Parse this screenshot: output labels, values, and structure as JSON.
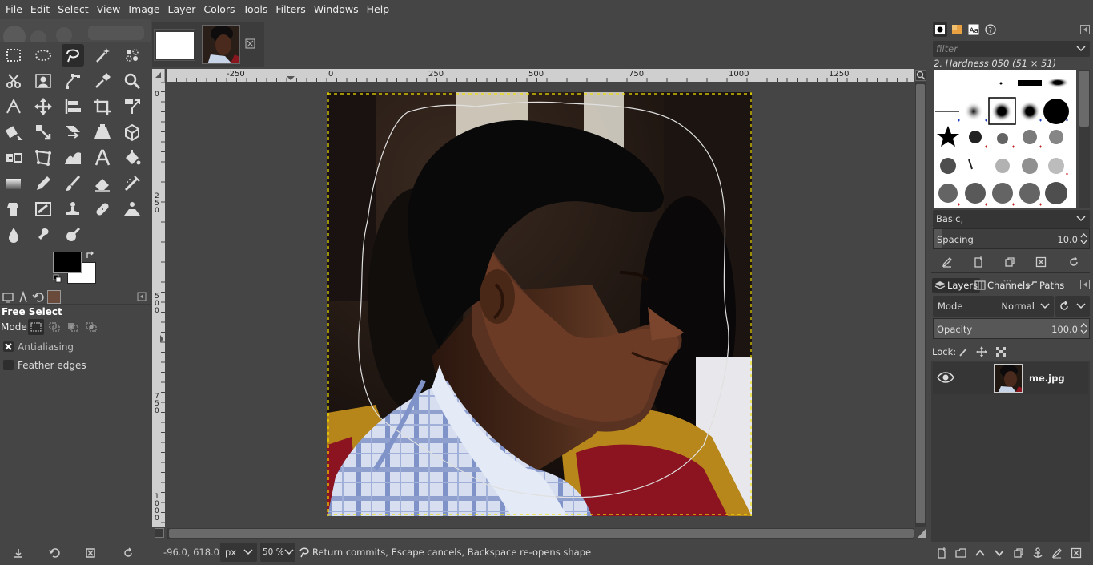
{
  "menubar": {
    "items": [
      "File",
      "Edit",
      "Select",
      "View",
      "Image",
      "Layer",
      "Colors",
      "Tools",
      "Filters",
      "Windows",
      "Help"
    ]
  },
  "toolbox": {
    "tools": [
      "rect-select-icon",
      "ellipse-select-icon",
      "free-select-icon",
      "fuzzy-select-icon",
      "color-select-icon",
      "scissors-select-icon",
      "foreground-select-icon",
      "paths-icon",
      "color-picker-icon",
      "zoom-icon",
      "measure-icon",
      "move-icon",
      "align-icon",
      "crop-icon",
      "unified-transform-icon",
      "rotate-icon",
      "scale-icon",
      "shear-icon",
      "perspective-icon",
      "3d-transform-icon",
      "flip-icon",
      "cage-transform-icon",
      "warp-transform-icon",
      "text-icon",
      "bucket-fill-icon",
      "gradient-icon",
      "pencil-icon",
      "paintbrush-icon",
      "eraser-icon",
      "airbrush-icon",
      "ink-icon",
      "mypaint-brush-icon",
      "clone-icon",
      "heal-icon",
      "perspective-clone-icon",
      "blur-icon",
      "smudge-icon",
      "dodge-burn-icon"
    ],
    "active_tool": "free-select-icon",
    "fg_color": "#000000",
    "bg_color": "#ffffff"
  },
  "tool_options": {
    "title": "Free Select",
    "mode_label": "Mode:",
    "antialiasing_label": "Antialiasing",
    "antialiasing_checked": true,
    "feather_label": "Feather edges",
    "feather_checked": false
  },
  "rulers": {
    "top_labels": [
      "-250",
      "0",
      "250",
      "500",
      "750",
      "1000",
      "1250"
    ],
    "left_labels": [
      "0",
      "2\n5\n0",
      "5\n0\n0",
      "7\n5\n0",
      "1\n0\n0\n0"
    ]
  },
  "statusbar": {
    "coords": "-96.0, 618.0",
    "unit": "px",
    "zoom": "50 %",
    "message": "Return commits, Escape cancels, Backspace re-opens shape"
  },
  "brushes": {
    "filter_placeholder": "filter",
    "selected_brush": "2. Hardness 050 (51 × 51)",
    "preset": "Basic,",
    "spacing_label": "Spacing",
    "spacing_value": "10.0",
    "spacing_fraction": 0.05
  },
  "layers_panel": {
    "tabs": [
      "Layers",
      "Channels",
      "Paths"
    ],
    "mode_label": "Mode",
    "mode_value": "Normal",
    "opacity_label": "Opacity",
    "opacity_value": "100.0",
    "opacity_fraction": 1.0,
    "lock_label": "Lock:",
    "layers": [
      {
        "name": "me.jpg",
        "visible": true
      }
    ]
  }
}
